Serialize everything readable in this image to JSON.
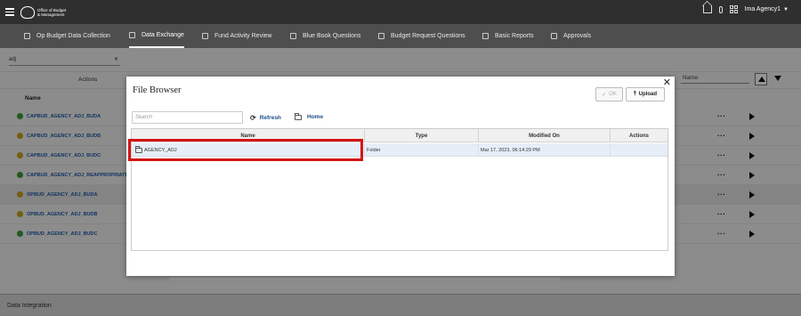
{
  "header": {
    "org_name": "Office of Budget & Management",
    "user_name": "Ima Agency1"
  },
  "nav": {
    "tabs": [
      {
        "label": "Op Budget Data Collection",
        "active": false
      },
      {
        "label": "Data Exchange",
        "active": true
      },
      {
        "label": "Fund Activity Review",
        "active": false
      },
      {
        "label": "Blue Book Questions",
        "active": false
      },
      {
        "label": "Budget Request Questions",
        "active": false
      },
      {
        "label": "Basic Reports",
        "active": false
      },
      {
        "label": "Approvals",
        "active": false
      }
    ]
  },
  "background": {
    "search_value": "adj",
    "actions_label": "Actions",
    "name_header": "Name",
    "name_filter_label": "Name",
    "rows": [
      {
        "label": "CAPBUD_AGENCY_ADJ_BUDA",
        "status": "ok",
        "status_color": "#3a9a3a"
      },
      {
        "label": "CAPBUD_AGENCY_ADJ_BUDB",
        "status": "warning",
        "status_color": "#c9a21a"
      },
      {
        "label": "CAPBUD_AGENCY_ADJ_BUDC",
        "status": "warning",
        "status_color": "#c9a21a"
      },
      {
        "label": "CAPBUD_AGENCY_ADJ_REAPPROPRIATE",
        "status": "ok",
        "status_color": "#3a9a3a"
      },
      {
        "label": "OPBUD_AGENCY_ADJ_BUDA",
        "status": "warning",
        "status_color": "#c9a21a"
      },
      {
        "label": "OPBUD_AGENCY_ADJ_BUDB",
        "status": "warning",
        "status_color": "#c9a21a"
      },
      {
        "label": "OPBUD_AGENCY_ADJ_BUDC",
        "status": "ok",
        "status_color": "#3a9a3a"
      }
    ]
  },
  "footer": {
    "label": "Data Integration"
  },
  "dialog": {
    "title": "File Browser",
    "ok_label": "OK",
    "upload_label": "Upload",
    "search_placeholder": "Search",
    "refresh_label": "Refresh",
    "home_label": "Home",
    "columns": [
      "Name",
      "Type",
      "Modified On",
      "Actions"
    ],
    "rows": [
      {
        "name": "AGENCY_ADJ",
        "type": "Folder",
        "modified_on": "Mar 17, 2023, 06:14:29 PM",
        "actions": ""
      }
    ]
  }
}
